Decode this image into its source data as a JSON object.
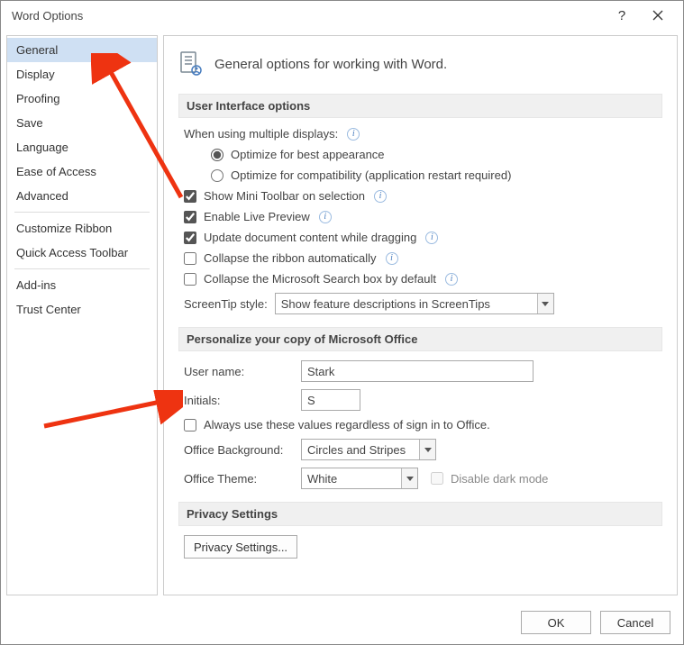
{
  "window": {
    "title": "Word Options"
  },
  "sidebar": {
    "items": [
      {
        "label": "General",
        "selected": true
      },
      {
        "label": "Display"
      },
      {
        "label": "Proofing"
      },
      {
        "label": "Save"
      },
      {
        "label": "Language"
      },
      {
        "label": "Ease of Access"
      },
      {
        "label": "Advanced"
      },
      {
        "sep": true
      },
      {
        "label": "Customize Ribbon"
      },
      {
        "label": "Quick Access Toolbar"
      },
      {
        "sep": true
      },
      {
        "label": "Add-ins"
      },
      {
        "label": "Trust Center"
      }
    ]
  },
  "heading": "General options for working with Word.",
  "sections": {
    "ui": {
      "title": "User Interface options",
      "multi_displays_label": "When using multiple displays:",
      "radio_best": "Optimize for best appearance",
      "radio_compat": "Optimize for compatibility (application restart required)",
      "check_mini_toolbar": "Show Mini Toolbar on selection",
      "check_live_preview": "Enable Live Preview",
      "check_update_drag": "Update document content while dragging",
      "check_collapse_ribbon": "Collapse the ribbon automatically",
      "check_collapse_search": "Collapse the Microsoft Search box by default",
      "screentip_label": "ScreenTip style:",
      "screentip_value": "Show feature descriptions in ScreenTips"
    },
    "personalize": {
      "title": "Personalize your copy of Microsoft Office",
      "username_label": "User name:",
      "username_value": "Stark",
      "initials_label": "Initials:",
      "initials_value": "S",
      "always_use": "Always use these values regardless of sign in to Office.",
      "background_label": "Office Background:",
      "background_value": "Circles and Stripes",
      "theme_label": "Office Theme:",
      "theme_value": "White",
      "disable_dark": "Disable dark mode"
    },
    "privacy": {
      "title": "Privacy Settings",
      "button": "Privacy Settings..."
    }
  },
  "footer": {
    "ok": "OK",
    "cancel": "Cancel"
  },
  "icons": {
    "help": "?",
    "info": "i"
  }
}
